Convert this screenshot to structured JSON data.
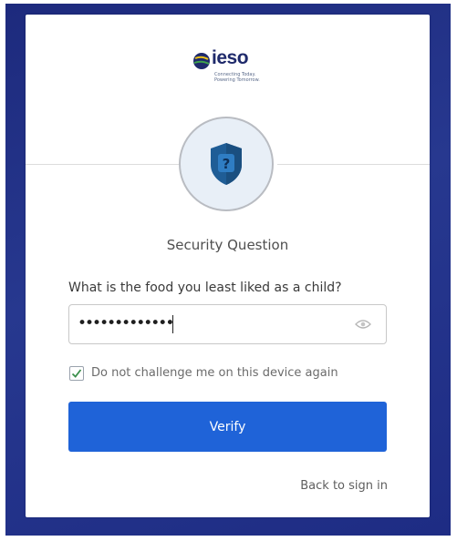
{
  "brand": {
    "name": "ieso",
    "tagline_line1": "Connecting Today.",
    "tagline_line2": "Powering Tomorrow."
  },
  "badge": {
    "glyph": "?",
    "icon": "shield-question-icon"
  },
  "form": {
    "title": "Security Question",
    "question": "What is the food you least liked as a child?",
    "answer_masked": "•••••••••••••",
    "remember_checked": true,
    "remember_label": "Do not challenge me on this device again",
    "verify_label": "Verify",
    "back_link": "Back to sign in"
  },
  "colors": {
    "background": "#27388f",
    "primary": "#1f63d8",
    "shield": "#1f5d96"
  }
}
